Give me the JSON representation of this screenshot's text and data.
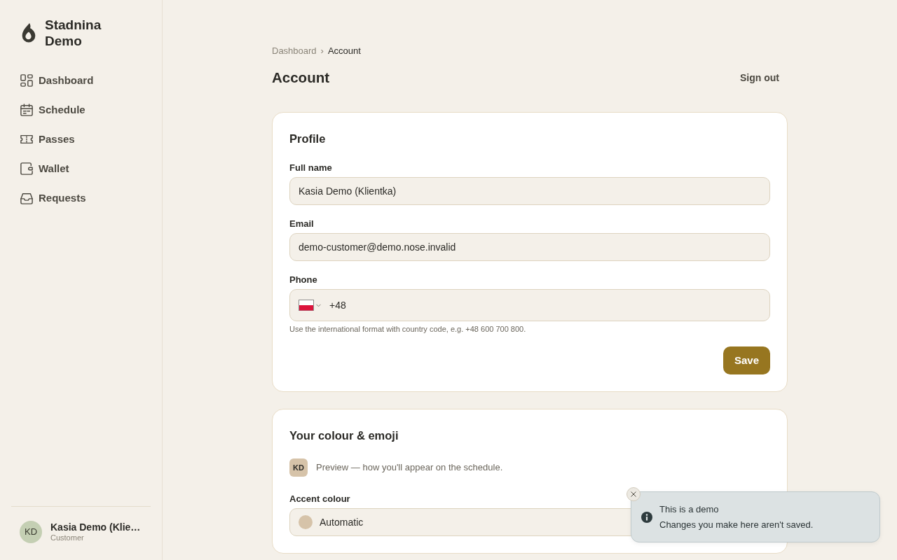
{
  "sidebar": {
    "brand": "Stadnina Demo",
    "items": [
      {
        "label": "Dashboard",
        "selected": false
      },
      {
        "label": "Schedule",
        "selected": false
      },
      {
        "label": "Passes",
        "selected": false
      },
      {
        "label": "Wallet",
        "selected": false
      },
      {
        "label": "Requests",
        "selected": false
      }
    ],
    "user": {
      "initials": "KD",
      "name": "Kasia Demo (Klie…",
      "role": "Customer"
    }
  },
  "breadcrumb": {
    "separator": "›",
    "items": [
      {
        "label": "Dashboard",
        "current": false
      },
      {
        "label": "Account",
        "current": true
      }
    ]
  },
  "header": {
    "title": "Account",
    "sign_out": "Sign out"
  },
  "profile_card": {
    "title": "Profile",
    "fields": [
      {
        "kind": "text",
        "label": "Full name",
        "value": "Kasia Demo (Klientka)"
      },
      {
        "kind": "text",
        "label": "Email",
        "value": "demo-customer@demo.nose.invalid"
      },
      {
        "kind": "phone",
        "label": "Phone",
        "value": "+48",
        "hint": "Use the international format with country code, e.g. +48 600 700 800."
      }
    ],
    "save_button": "Save"
  },
  "colour_card": {
    "title": "Your colour & emoji",
    "preview": {
      "initials": "KD",
      "text": "Preview — how you'll appear on the schedule."
    },
    "accent": {
      "label": "Accent colour",
      "value": "Automatic",
      "color": "#d6c3a9"
    }
  },
  "toast": {
    "title": "This is a demo",
    "message": "Changes you make here aren't saved."
  }
}
